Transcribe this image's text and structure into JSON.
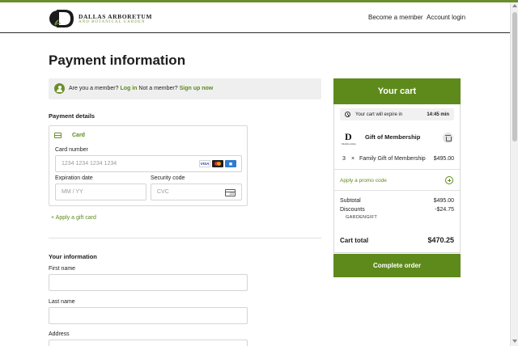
{
  "header": {
    "logo_name": "DALLAS ARBORETUM",
    "logo_sub": "AND BOTANICAL GARDEN",
    "nav": [
      {
        "label": "Become a member"
      },
      {
        "label": "Account login"
      }
    ]
  },
  "main": {
    "title": "Payment information",
    "member_bar": {
      "prefix": "Are you a member?",
      "login_label": "Log in",
      "middle": "Not a member?",
      "signup_label": "Sign up now"
    },
    "payment_details": {
      "heading": "Payment details",
      "method_label": "Card",
      "card_number_label": "Card number",
      "card_number_placeholder": "1234 1234 1234 1234",
      "expiration_label": "Expiration date",
      "expiration_placeholder": "MM / YY",
      "security_label": "Security code",
      "security_placeholder": "CVC",
      "card_brands": [
        "VISA",
        "Mastercard",
        "AMEX"
      ],
      "cvc_icon_text": "123"
    },
    "gift_card_label": "+ Apply a gift card",
    "your_information": {
      "heading": "Your information",
      "first_name_label": "First name",
      "last_name_label": "Last name",
      "address_label": "Address"
    }
  },
  "cart": {
    "title": "Your cart",
    "timer_text": "Your cart will expire in",
    "timer_value": "14:45 min",
    "item": {
      "logo_letter": "D",
      "logo_sub": "Membership",
      "name": "Gift of Membership",
      "quantity": "3",
      "times": "×",
      "description": "Family Gift of Membership",
      "price": "$495.00"
    },
    "promo_label": "Apply a promo code",
    "subtotal_label": "Subtotal",
    "subtotal_value": "$495.00",
    "discounts_label": "Discounts",
    "discounts_value": "-$24.75",
    "discount_code": "GARDENGIFT",
    "total_label": "Cart total",
    "total_value": "$470.25",
    "complete_label": "Complete order"
  },
  "colors": {
    "accent": "#5e8a1c",
    "top_bar": "#6b8f2a"
  },
  "icons": [
    "member-icon",
    "card-icon",
    "clock-icon",
    "trash-icon",
    "plus-circle-icon",
    "cvc-card-icon"
  ]
}
